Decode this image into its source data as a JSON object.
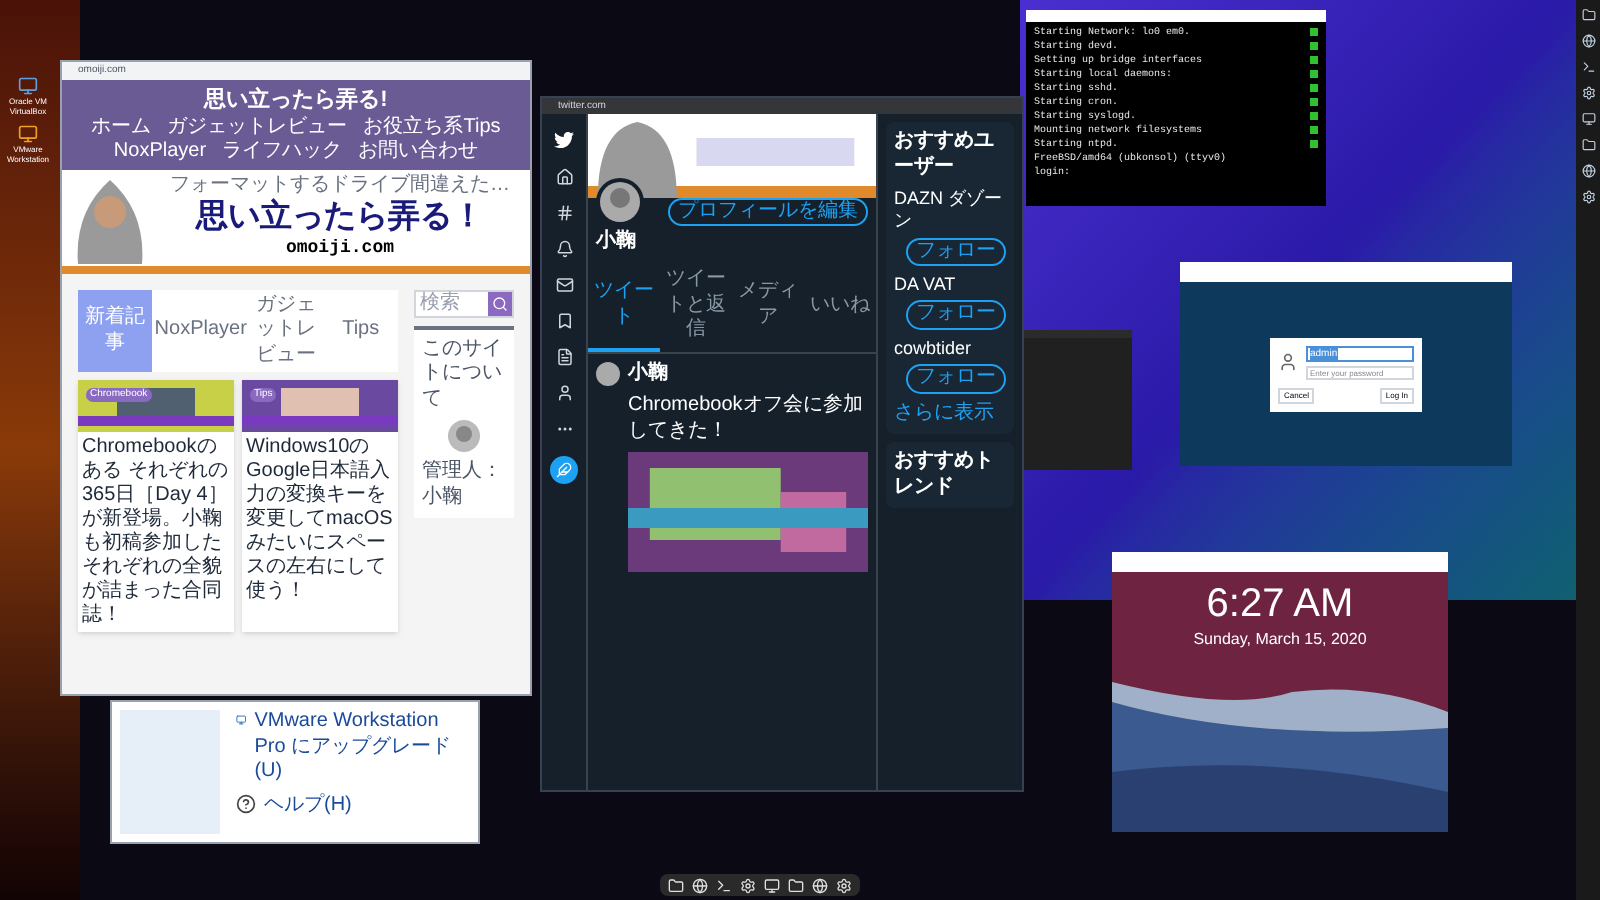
{
  "desktop_icons": [
    {
      "label": "Oracle VM VirtualBox"
    },
    {
      "label": "VMware Workstation"
    }
  ],
  "browser": {
    "url": "omoiji.com",
    "site_title": "思い立ったら弄る!",
    "nav": [
      "ホーム",
      "ガジェットレビュー",
      "お役立ち系Tips",
      "NoxPlayer",
      "ライフハック",
      "お問い合わせ"
    ],
    "banner": {
      "tagline": "フォーマットするドライブ間違えた…",
      "title": "思い立ったら弄る！",
      "domain": "omoiji.com"
    },
    "tabs": [
      {
        "label": "新着記事",
        "selected": true
      },
      {
        "label": "NoxPlayer",
        "selected": false
      },
      {
        "label": "ガジェットレビュー",
        "selected": false
      },
      {
        "label": "Tips",
        "selected": false
      }
    ],
    "search": {
      "placeholder": "検索"
    },
    "cards": [
      {
        "tag": "Chromebook",
        "title": "Chromebookのある それぞれの365日［Day 4］が新登場。小鞠も初稿参加したそれぞれの全貌が詰まった合同誌！"
      },
      {
        "tag": "Tips",
        "title": "Windows10のGoogle日本語入力の変換キーを変更してmacOSみたいにスペースの左右にして使う！"
      }
    ],
    "sidebar": {
      "heading": "このサイトについて",
      "admin": "管理人：小鞠"
    }
  },
  "vmware_dialog": {
    "items": [
      "VMware Workstation Pro にアップグレード(U)",
      "ヘルプ(H)"
    ]
  },
  "twitter": {
    "url": "twitter.com",
    "name": "小鞠",
    "edit_button": "プロフィールを編集",
    "tabs": [
      {
        "label": "ツイート",
        "selected": true
      },
      {
        "label": "ツイートと返信",
        "selected": false
      },
      {
        "label": "メディア",
        "selected": false
      },
      {
        "label": "いいね",
        "selected": false
      }
    ],
    "tweet": {
      "author": "小鞠",
      "text": "Chromebookオフ会に参加してきた！"
    },
    "suggest_heading": "おすすめユーザー",
    "users": [
      {
        "name": "DAZN ダゾーン",
        "button": "フォロー"
      },
      {
        "name": "DA VAT",
        "button": "フォロー"
      },
      {
        "name": "cowbtider",
        "button": "フォロー"
      }
    ],
    "more": "さらに表示",
    "trends_heading": "おすすめトレンド"
  },
  "terminal": {
    "lines": [
      {
        "text": "Starting Network: lo0 em0.",
        "ok": true
      },
      {
        "text": "Starting devd.",
        "ok": true
      },
      {
        "text": "Setting up bridge interfaces",
        "ok": true
      },
      {
        "text": "Starting local daemons:",
        "ok": true
      },
      {
        "text": "Starting sshd.",
        "ok": true
      },
      {
        "text": "Starting cron.",
        "ok": true
      },
      {
        "text": "Starting syslogd.",
        "ok": true
      },
      {
        "text": "Mounting network filesystems",
        "ok": true
      },
      {
        "text": "Starting ntpd.",
        "ok": true
      },
      {
        "text": "FreeBSD/amd64 (ubkonsol) (ttyv0)",
        "ok": false
      },
      {
        "text": "login:",
        "ok": false
      }
    ]
  },
  "login": {
    "username": "admin",
    "password_placeholder": "Enter your password",
    "cancel": "Cancel",
    "login": "Log In"
  },
  "lock_screen": {
    "time": "6:27 AM",
    "date": "Sunday, March 15, 2020"
  }
}
